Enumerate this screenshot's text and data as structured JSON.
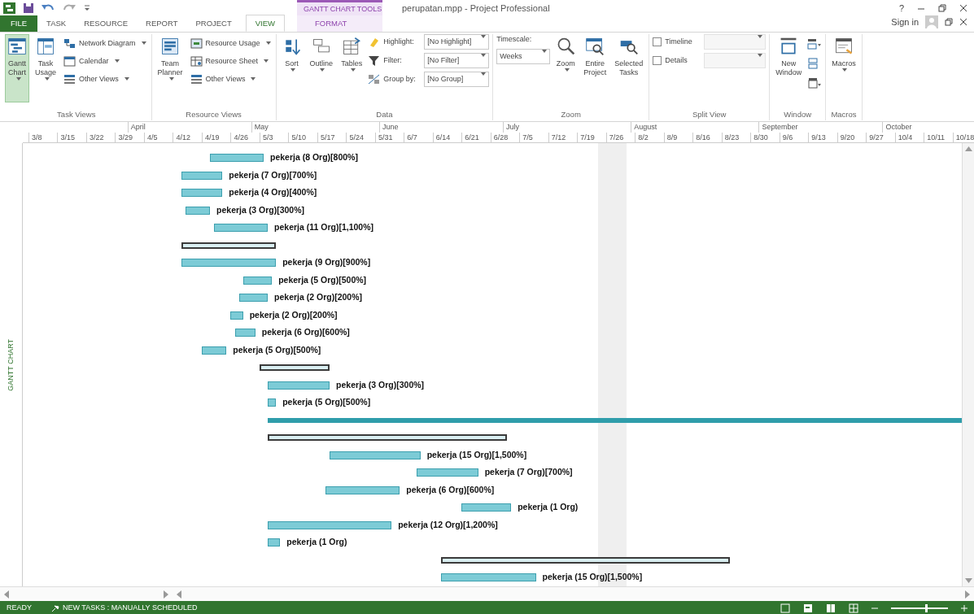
{
  "window": {
    "title": "perupatan.mpp - Project Professional",
    "help": "?",
    "sign_in": "Sign in"
  },
  "contextual_title": "GANTT CHART TOOLS",
  "ribbon_tabs": [
    {
      "label": "FILE",
      "kind": "file",
      "selected": false
    },
    {
      "label": "TASK",
      "kind": "tab",
      "selected": false
    },
    {
      "label": "RESOURCE",
      "kind": "tab",
      "selected": false
    },
    {
      "label": "REPORT",
      "kind": "tab",
      "selected": false
    },
    {
      "label": "PROJECT",
      "kind": "tab",
      "selected": false
    },
    {
      "label": "VIEW",
      "kind": "tab",
      "selected": true
    },
    {
      "label": "FORMAT",
      "kind": "contextual",
      "selected": false
    }
  ],
  "groups": [
    {
      "title": "Task Views",
      "items": [
        {
          "kind": "large",
          "label": "Gantt Chart",
          "dropdown": true,
          "selected": true
        },
        {
          "kind": "large",
          "label": "Task Usage",
          "dropdown": true,
          "selected": false
        },
        {
          "kind": "stack",
          "items": [
            {
              "label": "Network Diagram",
              "dropdown": true
            },
            {
              "label": "Calendar",
              "dropdown": true
            },
            {
              "label": "Other Views",
              "dropdown": true
            }
          ]
        }
      ]
    },
    {
      "title": "Resource Views",
      "items": [
        {
          "kind": "large",
          "label": "Team Planner",
          "dropdown": true,
          "selected": false
        },
        {
          "kind": "stack",
          "items": [
            {
              "label": "Resource Usage",
              "dropdown": true
            },
            {
              "label": "Resource Sheet",
              "dropdown": true
            },
            {
              "label": "Other Views",
              "dropdown": true
            }
          ]
        }
      ]
    },
    {
      "title": "Data",
      "items": [
        {
          "kind": "large",
          "label": "Sort",
          "dropdown": true,
          "selected": false
        },
        {
          "kind": "large",
          "label": "Outline",
          "dropdown": true,
          "selected": false
        },
        {
          "kind": "large",
          "label": "Tables",
          "dropdown": true,
          "selected": false
        },
        {
          "kind": "selects",
          "items": [
            {
              "label": "Highlight:",
              "value": "[No Highlight]"
            },
            {
              "label": "Filter:",
              "value": "[No Filter]"
            },
            {
              "label": "Group by:",
              "value": "[No Group]"
            }
          ]
        }
      ]
    },
    {
      "title": "Zoom",
      "items": [
        {
          "kind": "timescale",
          "label": "Timescale:",
          "value": "Weeks"
        },
        {
          "kind": "large",
          "label": "Zoom",
          "dropdown": true,
          "selected": false
        },
        {
          "kind": "large",
          "label": "Entire Project",
          "dropdown": false,
          "selected": false
        },
        {
          "kind": "large",
          "label": "Selected Tasks",
          "dropdown": false,
          "selected": false
        }
      ]
    },
    {
      "title": "Split View",
      "items": [
        {
          "kind": "checks",
          "items": [
            {
              "label": "Timeline",
              "checked": false
            },
            {
              "label": "Details",
              "checked": false
            }
          ]
        }
      ]
    },
    {
      "title": "Window",
      "items": [
        {
          "kind": "large",
          "label": "New Window",
          "dropdown": false,
          "selected": false
        },
        {
          "kind": "icons"
        }
      ]
    },
    {
      "title": "Macros",
      "items": [
        {
          "kind": "large",
          "label": "Macros",
          "dropdown": true,
          "selected": false
        }
      ]
    }
  ],
  "side_label": "GANTT CHART",
  "timescale": {
    "months": [
      "April",
      "May",
      "June",
      "July",
      "August",
      "September",
      "October"
    ],
    "weeks": [
      "3/8",
      "3/15",
      "3/22",
      "3/29",
      "4/5",
      "4/12",
      "4/19",
      "4/26",
      "5/3",
      "5/10",
      "5/17",
      "5/24",
      "5/31",
      "6/7",
      "6/14",
      "6/21",
      "6/28",
      "7/5",
      "7/12",
      "7/19",
      "7/26",
      "8/2",
      "8/9",
      "8/16",
      "8/23",
      "8/30",
      "9/6",
      "9/13",
      "9/20",
      "9/27",
      "10/4",
      "10/11",
      "10/18"
    ]
  },
  "tasks": [
    {
      "kind": "task",
      "label": "pekerja (8 Org)[800%]"
    },
    {
      "kind": "task",
      "label": "pekerja (7 Org)[700%]"
    },
    {
      "kind": "task",
      "label": "pekerja (4 Org)[400%]"
    },
    {
      "kind": "task",
      "label": "pekerja (3 Org)[300%]"
    },
    {
      "kind": "task",
      "label": "pekerja (11 Org)[1,100%]"
    },
    {
      "kind": "summary"
    },
    {
      "kind": "task",
      "label": "pekerja (9 Org)[900%]"
    },
    {
      "kind": "task",
      "label": "pekerja (5 Org)[500%]"
    },
    {
      "kind": "task",
      "label": "pekerja (2 Org)[200%]"
    },
    {
      "kind": "task",
      "label": "pekerja (2 Org)[200%]"
    },
    {
      "kind": "task",
      "label": "pekerja (6 Org)[600%]"
    },
    {
      "kind": "task",
      "label": "pekerja (5 Org)[500%]"
    },
    {
      "kind": "summary"
    },
    {
      "kind": "task",
      "label": "pekerja (3 Org)[300%]"
    },
    {
      "kind": "task",
      "label": "pekerja (5 Org)[500%]"
    },
    {
      "kind": "span"
    },
    {
      "kind": "summary"
    },
    {
      "kind": "task",
      "label": "pekerja (15 Org)[1,500%]"
    },
    {
      "kind": "task",
      "label": "pekerja (7 Org)[700%]"
    },
    {
      "kind": "task",
      "label": "pekerja (6 Org)[600%]"
    },
    {
      "kind": "task",
      "label": "pekerja (1 Org)"
    },
    {
      "kind": "task",
      "label": "pekerja (12 Org)[1,200%]"
    },
    {
      "kind": "task",
      "label": "pekerja (1 Org)"
    },
    {
      "kind": "summary"
    },
    {
      "kind": "task",
      "label": "pekerja (15 Org)[1,500%]"
    }
  ],
  "status_bar": {
    "ready": "READY",
    "new_tasks": "NEW TASKS : MANUALLY SCHEDULED",
    "zoom": {
      "level": 0.6
    }
  }
}
